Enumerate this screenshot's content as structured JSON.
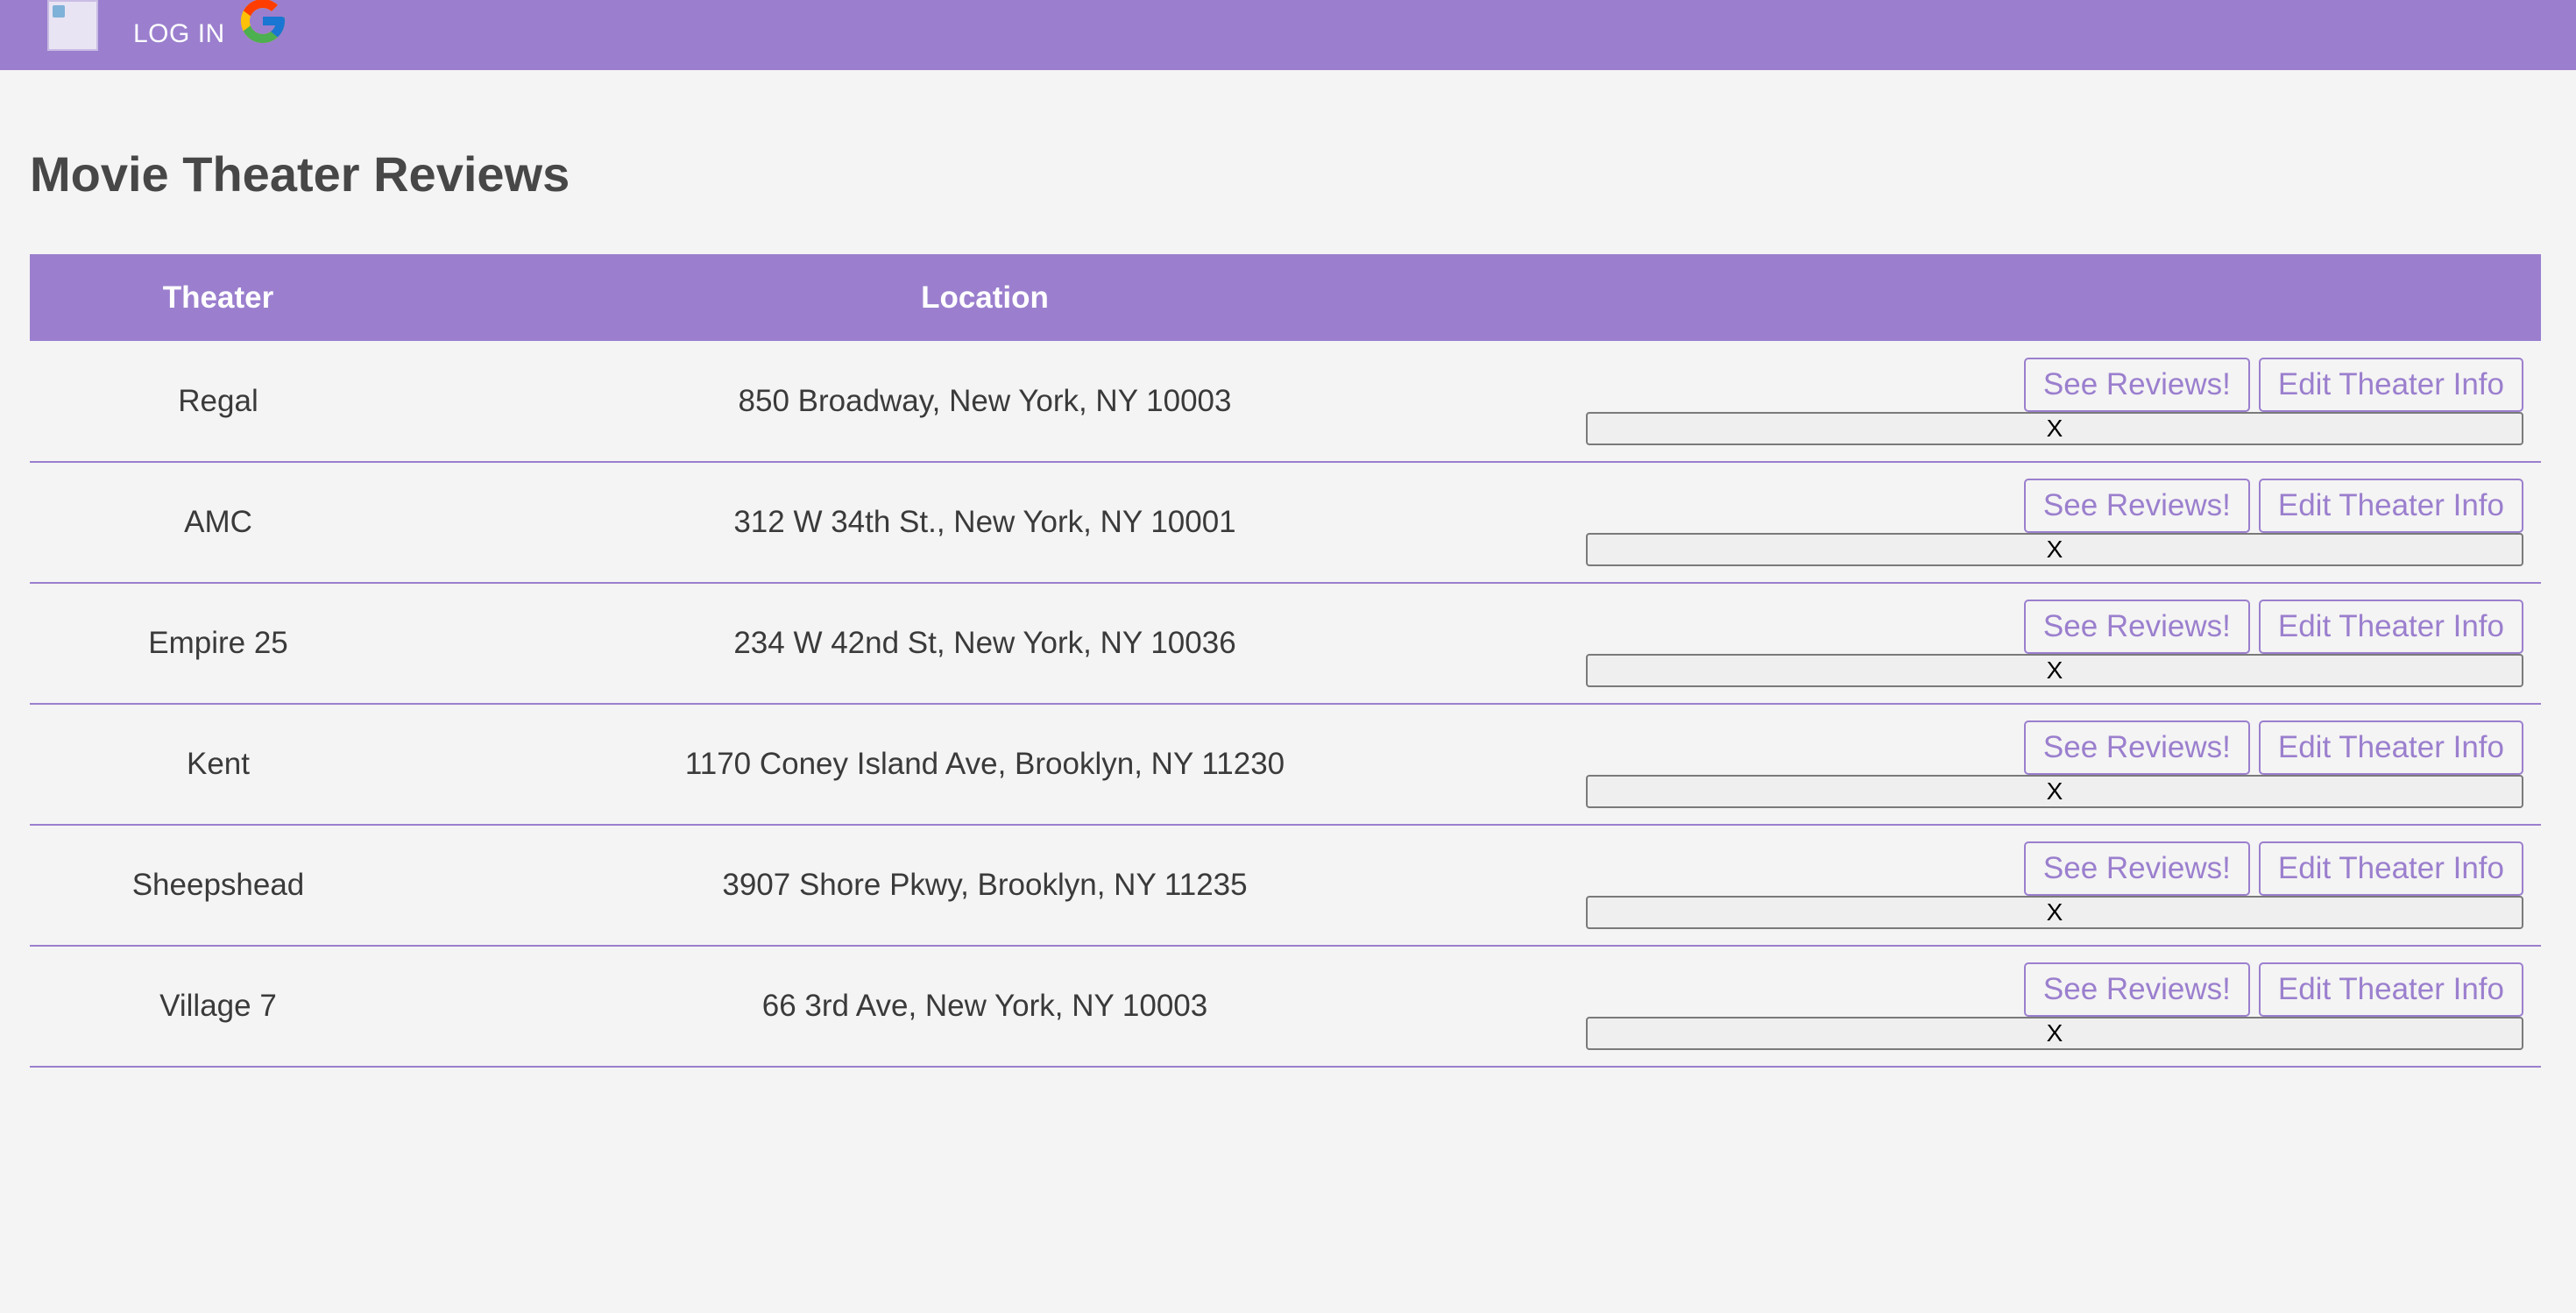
{
  "header": {
    "login_label": "LOG IN",
    "google_icon": "google-g-icon",
    "colors": {
      "bar": "#9b7fce",
      "text": "#ffffff"
    }
  },
  "page": {
    "title": "Movie Theater Reviews"
  },
  "table": {
    "columns": [
      "Theater",
      "Location",
      ""
    ],
    "rows": [
      {
        "theater": "Regal",
        "location": "850 Broadway, New York, NY 10003"
      },
      {
        "theater": "AMC",
        "location": "312 W 34th St., New York, NY 10001"
      },
      {
        "theater": "Empire 25",
        "location": "234 W 42nd St, New York, NY 10036"
      },
      {
        "theater": "Kent",
        "location": "1170 Coney Island Ave, Brooklyn, NY 11230"
      },
      {
        "theater": "Sheepshead",
        "location": "3907 Shore Pkwy, Brooklyn, NY 11235"
      },
      {
        "theater": "Village 7",
        "location": "66 3rd Ave, New York, NY 10003"
      }
    ],
    "actions": {
      "see_reviews": "See Reviews!",
      "edit_info": "Edit Theater Info",
      "delete": "X"
    }
  },
  "colors": {
    "accent": "#9b7fce",
    "background": "#f4f4f4",
    "title_text": "#474747"
  }
}
